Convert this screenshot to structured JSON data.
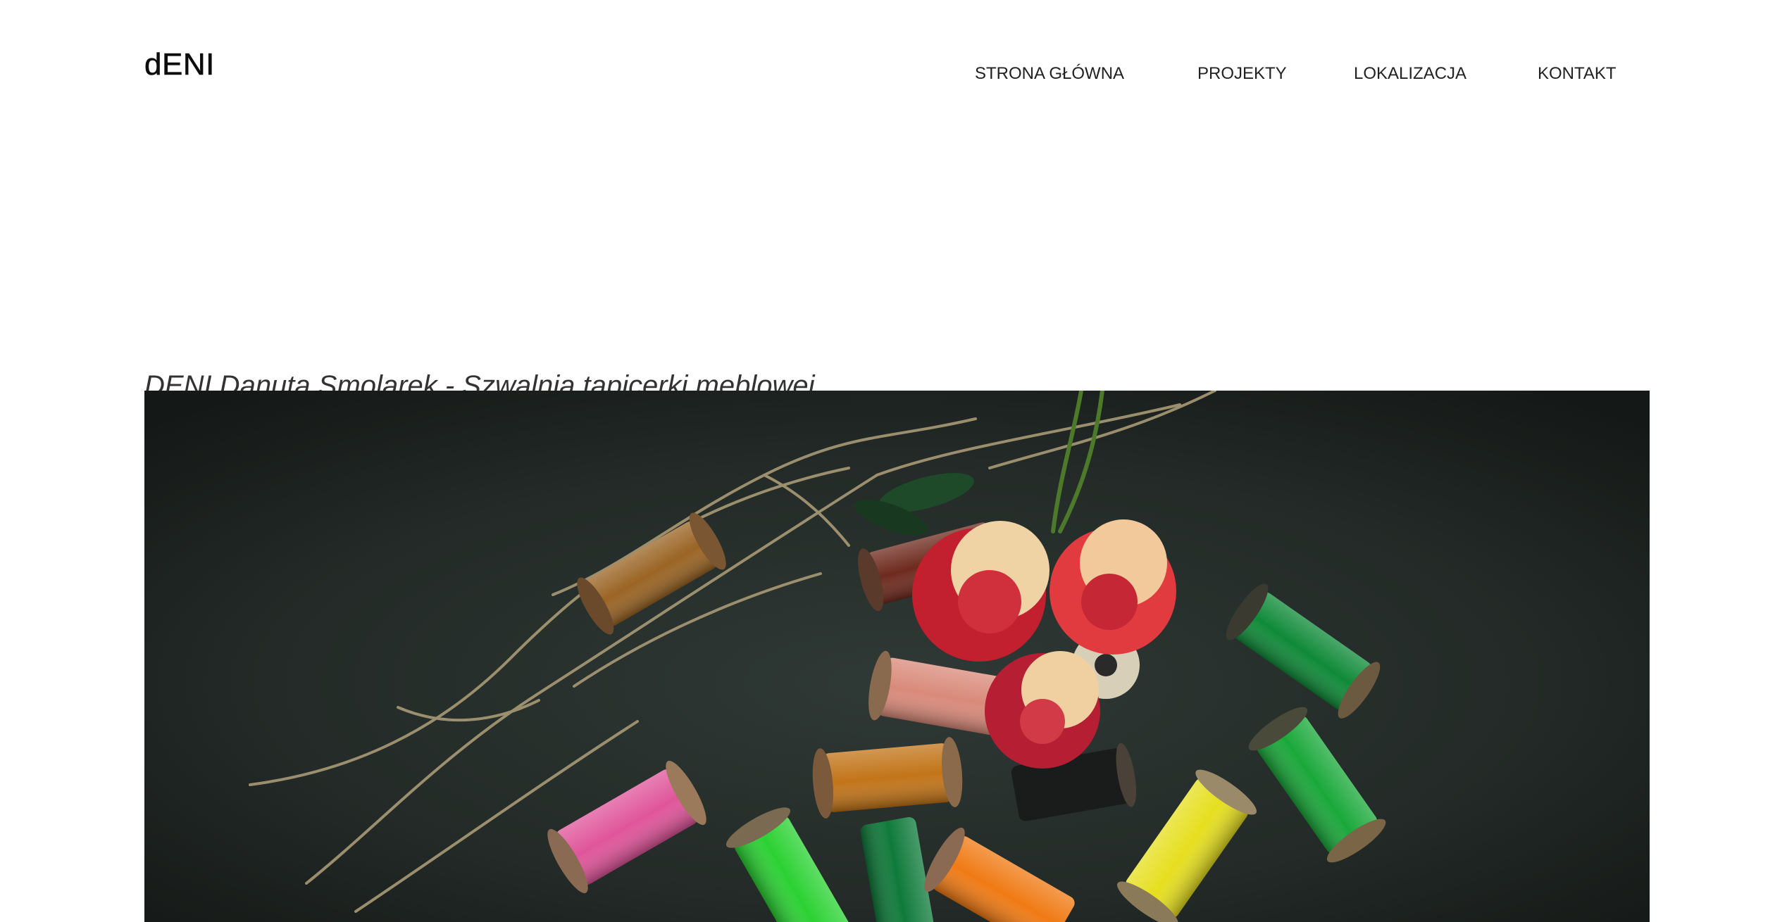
{
  "header": {
    "logo": "dENI",
    "nav": [
      {
        "label": "STRONA GŁÓWNA"
      },
      {
        "label": "PROJEKTY"
      },
      {
        "label": "LOKALIZACJA"
      },
      {
        "label": "KONTAKT"
      }
    ]
  },
  "main": {
    "subtitle": "DENI Danuta Smolarek - Szwalnia tapicerki meblowej",
    "hero_image": {
      "description_icon": "thread-spools-roses-photo-icon",
      "colors": {
        "background": "#1e2321",
        "pink": "#e0559a",
        "green": "#2bd133",
        "dark_green": "#0f7a3a",
        "orange": "#f07a14",
        "yellow": "#e6df1f",
        "brown": "#9a6424",
        "salmon": "#d98a7a",
        "rose_red": "#c21f2f",
        "rose_cream": "#f0d3a5"
      }
    }
  }
}
